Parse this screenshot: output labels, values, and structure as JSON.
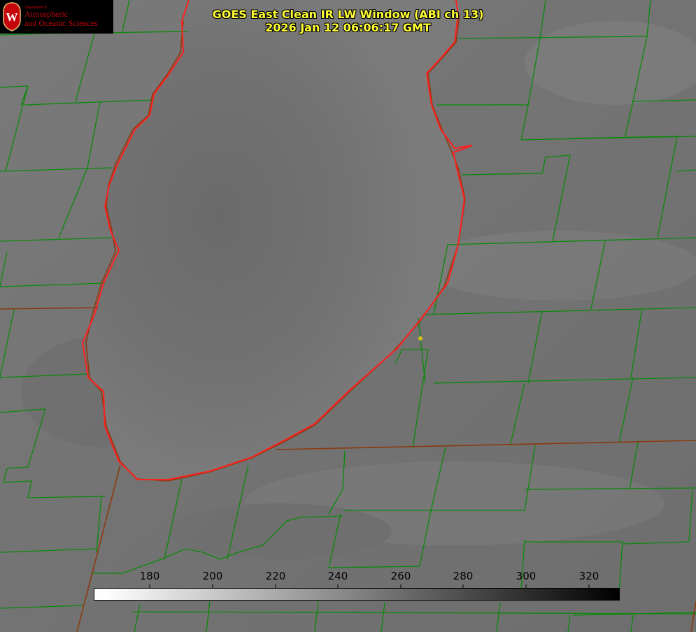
{
  "title": {
    "line1": "GOES East Clean IR LW Window (ABI ch 13)",
    "line2": "2026 Jan 12 06:06:17 GMT"
  },
  "logo": {
    "department": "Department of",
    "name_line1": "Atmospheric",
    "name_line2": "and Oceanic Sciences",
    "crest_letter": "W"
  },
  "colorbar": {
    "units": "",
    "ticks": [
      "180",
      "200",
      "220",
      "240",
      "260",
      "280",
      "300",
      "320"
    ],
    "range": [
      162,
      330
    ],
    "low_color": "#ffffff",
    "high_color": "#000000"
  },
  "colors": {
    "county_lines": "#0a8a0a",
    "state_lines": "#8b3a10",
    "shoreline": "#ff2020",
    "title_text": "#ffff33",
    "station_marker": "#d4c21a",
    "logo_red": "#c5050c"
  },
  "icons": {
    "crest": "uw-crest-icon",
    "station": "station-marker-icon"
  }
}
